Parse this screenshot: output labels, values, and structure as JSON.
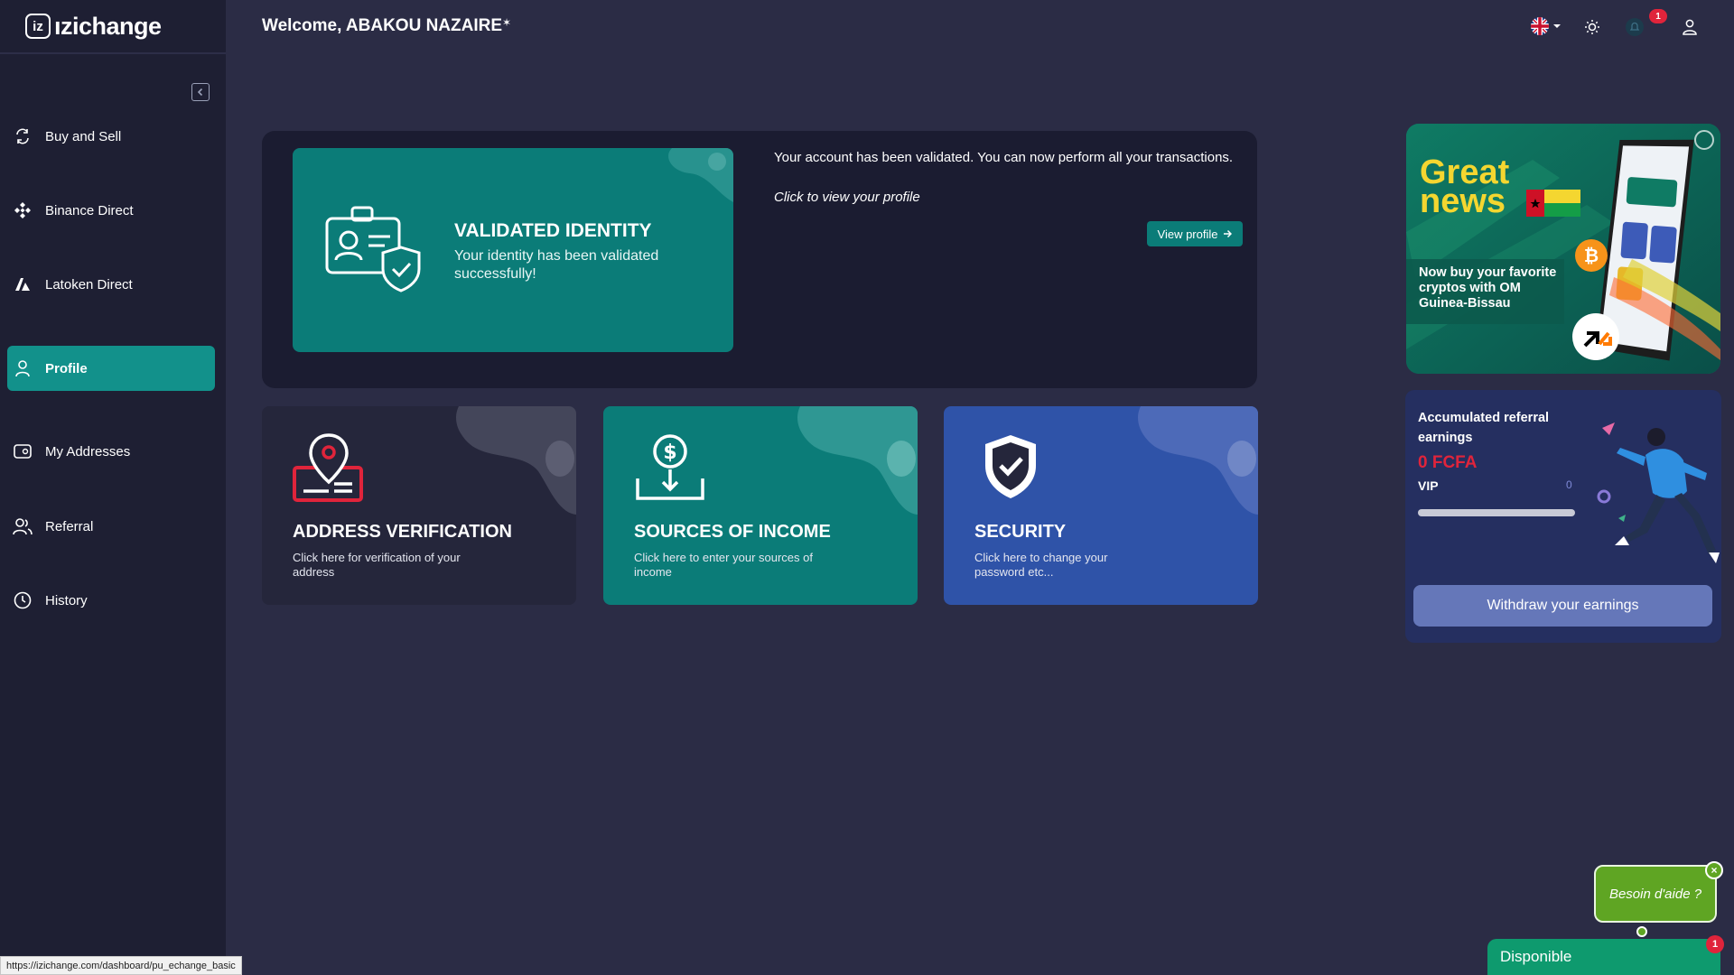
{
  "brand": {
    "logo_letter": "iz",
    "name": "ızichange"
  },
  "header": {
    "welcome": "Welcome, ABAKOU NAZAIRE",
    "notification_count": "1",
    "icons": [
      "uk-flag-icon",
      "sun-icon",
      "bell-icon",
      "user-icon"
    ]
  },
  "sidebar": {
    "items": [
      {
        "label": "Buy and Sell",
        "icon": "exchange-icon"
      },
      {
        "label": "Binance Direct",
        "icon": "binance-icon"
      },
      {
        "label": "Latoken Direct",
        "icon": "latoken-icon"
      },
      {
        "label": "Profile",
        "icon": "user-icon",
        "active": true
      },
      {
        "label": "My Addresses",
        "icon": "wallet-icon"
      },
      {
        "label": "Referral",
        "icon": "users-icon"
      },
      {
        "label": "History",
        "icon": "clock-icon"
      }
    ]
  },
  "identity": {
    "title": "VALIDATED IDENTITY",
    "subtitle": "Your identity has been validated successfully!",
    "message": "Your account has been validated. You can now perform all your transactions.",
    "click_text": "Click to view your profile",
    "button": "View profile"
  },
  "cards": [
    {
      "title": "ADDRESS VERIFICATION",
      "subtitle": "Click here for verification of your address",
      "icon": "location-icon",
      "color": "#25263b"
    },
    {
      "title": "SOURCES OF INCOME",
      "subtitle": "Click here to enter your sources of income",
      "icon": "money-download-icon",
      "color": "#0b7c78"
    },
    {
      "title": "SECURITY",
      "subtitle": "Click here to change your password etc...",
      "icon": "shield-check-icon",
      "color": "#2f53a8"
    }
  ],
  "promo": {
    "headline_1": "Great",
    "headline_2": "news",
    "text": "Now buy your favorite cryptos with OM Guinea-Bissau"
  },
  "referral": {
    "label": "Accumulated referral earnings",
    "amount": "0 FCFA",
    "tier": "VIP",
    "progress_text": "0",
    "progress_fraction": 0,
    "button": "Withdraw your earnings"
  },
  "help": {
    "bubble": "Besoin d'aide ?",
    "close": "×",
    "status": "Disponible",
    "badge": "1"
  },
  "status_bar_url": "https://izichange.com/dashboard/pu_echange_basic",
  "colors": {
    "accent": "#12918b",
    "danger": "#e0243b",
    "security": "#2f53a8",
    "help": "#5fa523"
  }
}
